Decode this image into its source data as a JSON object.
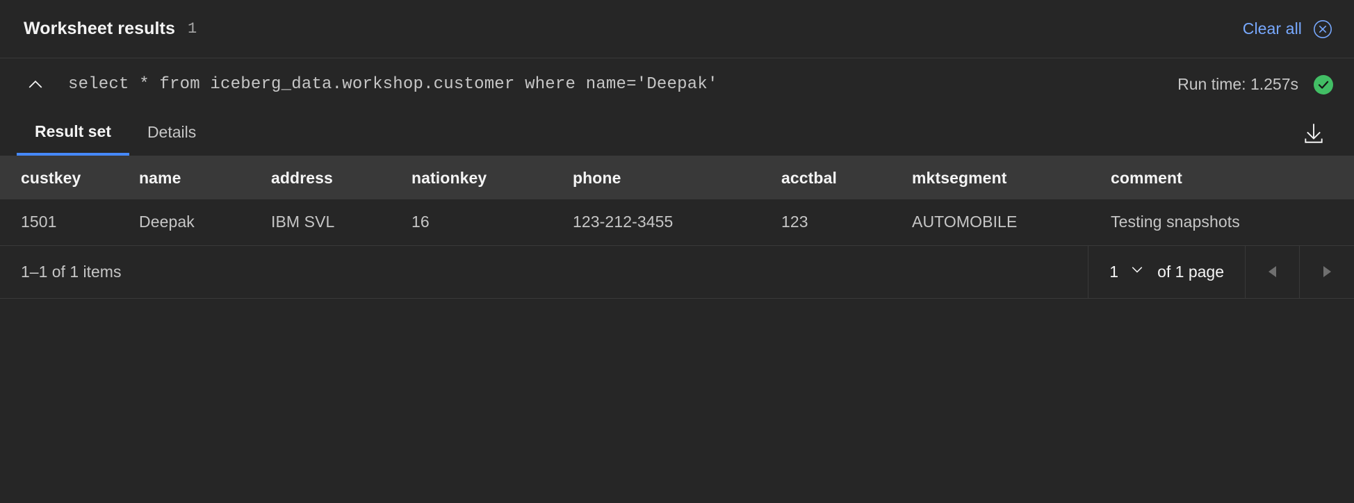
{
  "header": {
    "title": "Worksheet results",
    "count": "1",
    "clear_all_label": "Clear all",
    "clear_icon": "close-circle-icon"
  },
  "query": {
    "collapse_icon": "chevron-up-icon",
    "sql": "select * from iceberg_data.workshop.customer where name='Deepak'",
    "runtime_label": "Run time: 1.257s",
    "status_icon": "checkmark-filled-icon",
    "status_color": "#42be65"
  },
  "tabs": {
    "items": [
      {
        "label": "Result set",
        "active": true
      },
      {
        "label": "Details",
        "active": false
      }
    ],
    "download_icon": "download-icon",
    "active_underline_color": "#4589ff"
  },
  "table": {
    "columns": [
      "custkey",
      "name",
      "address",
      "nationkey",
      "phone",
      "acctbal",
      "mktsegment",
      "comment"
    ],
    "rows": [
      [
        "1501",
        "Deepak",
        "IBM SVL",
        "16",
        "123-212-3455",
        "123",
        "AUTOMOBILE",
        "Testing snapshots"
      ]
    ]
  },
  "pagination": {
    "items_range": "1–1 of 1 items",
    "page_value": "1",
    "page_chevron_icon": "chevron-down-icon",
    "of_pages_label": "of 1 page",
    "prev_icon": "caret-left-icon",
    "next_icon": "caret-right-icon"
  },
  "colors": {
    "background": "#262626",
    "header_row": "#393939",
    "link": "#78a9ff",
    "accent": "#4589ff",
    "success": "#42be65",
    "text_primary": "#f4f4f4",
    "text_secondary": "#c6c6c6"
  }
}
